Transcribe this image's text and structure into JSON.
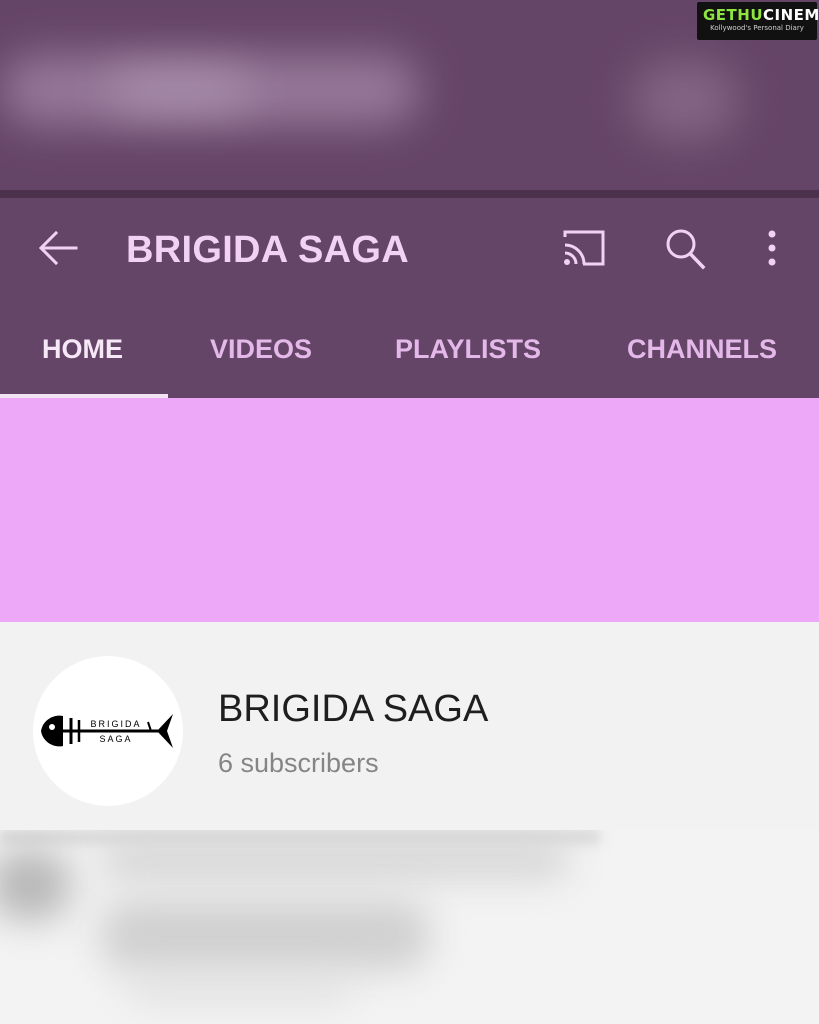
{
  "watermark": {
    "brand_part1": "GETHU",
    "brand_part2": "CINEMA",
    "tagline": "Kollywood's Personal Diary"
  },
  "app_bar": {
    "title": "BRIGIDA SAGA",
    "icons": [
      "back-arrow-icon",
      "cast-icon",
      "search-icon",
      "more-vert-icon"
    ]
  },
  "tabs": [
    {
      "label": "HOME",
      "active": true
    },
    {
      "label": "VIDEOS",
      "active": false
    },
    {
      "label": "PLAYLISTS",
      "active": false
    },
    {
      "label": "CHANNELS",
      "active": false
    }
  ],
  "channel": {
    "name": "BRIGIDA SAGA",
    "subscribers": "6 subscribers",
    "avatar_text_top": "BRIGIDA",
    "avatar_text_bottom": "SAGA"
  },
  "colors": {
    "app_bar": "#654567",
    "banner": "#eda8f8",
    "tab_active": "#f6e8f6",
    "tab_inactive": "#e4b9ea",
    "background": "#f2f2f2"
  }
}
